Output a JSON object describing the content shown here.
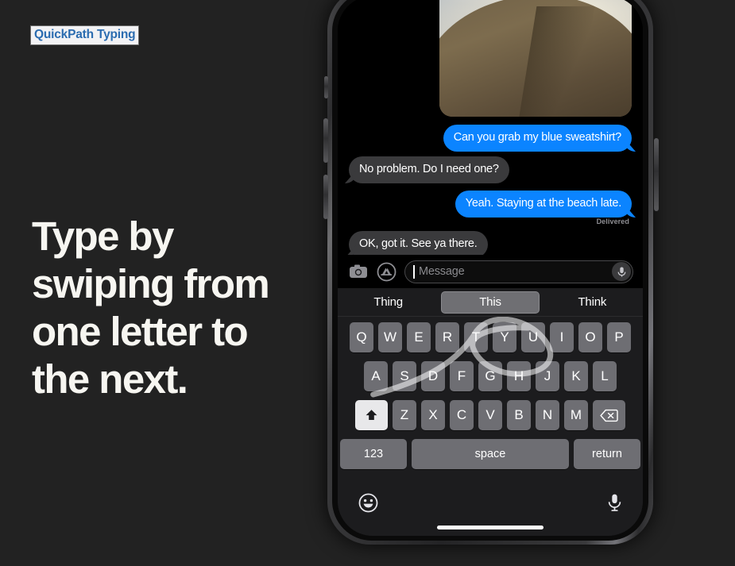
{
  "feature_tag": "QuickPath Typing",
  "headline": "Type by swiping from one letter to the next.",
  "colors": {
    "page_background": "#222222",
    "tag_text": "#2b6cb0",
    "tag_background": "#f2f2f4",
    "headline_text": "#f7f6f1",
    "bubble_outgoing": "#0b84ff",
    "bubble_incoming": "#3a3a3c",
    "key_background": "#6e6e73",
    "key_active": "#e8e8ea",
    "keyboard_background": "#1c1c1e"
  },
  "phone": {
    "conversation": {
      "attachment": {
        "name": "sand-dune-photo",
        "description": "Photo of a sand dune under a cloudy sky"
      },
      "messages": [
        {
          "text": "Can you grab my blue sweatshirt?",
          "direction": "outgoing"
        },
        {
          "text": "No problem. Do I need one?",
          "direction": "incoming"
        },
        {
          "text": "Yeah. Staying at the beach late.",
          "direction": "outgoing"
        },
        {
          "text": "OK, got it. See ya there.",
          "direction": "incoming"
        }
      ],
      "delivery_status": "Delivered"
    },
    "input_bar": {
      "camera_icon": "camera-icon",
      "appstore_icon": "app-store-icon",
      "placeholder": "Message",
      "mic_icon": "microphone-icon"
    },
    "keyboard": {
      "predictions": [
        {
          "label": "Thing",
          "selected": false
        },
        {
          "label": "This",
          "selected": true
        },
        {
          "label": "Think",
          "selected": false
        }
      ],
      "row1": [
        "Q",
        "W",
        "E",
        "R",
        "T",
        "Y",
        "U",
        "I",
        "O",
        "P"
      ],
      "row2": [
        "A",
        "S",
        "D",
        "F",
        "G",
        "H",
        "J",
        "K",
        "L"
      ],
      "row3": [
        "Z",
        "X",
        "C",
        "V",
        "B",
        "N",
        "M"
      ],
      "shift_icon": "shift-arrow-icon",
      "delete_icon": "backspace-icon",
      "numbers_label": "123",
      "space_label": "space",
      "return_label": "return",
      "swipe_trail": "quickpath-swipe-trail"
    },
    "bottom_bar": {
      "emoji_icon": "emoji-smiley-icon",
      "dictation_icon": "microphone-icon",
      "home_indicator": "home-indicator-bar"
    },
    "hardware": {
      "silent_switch": "silent-switch",
      "volume_up": "volume-up-button",
      "volume_down": "volume-down-button",
      "power": "side-power-button"
    }
  }
}
